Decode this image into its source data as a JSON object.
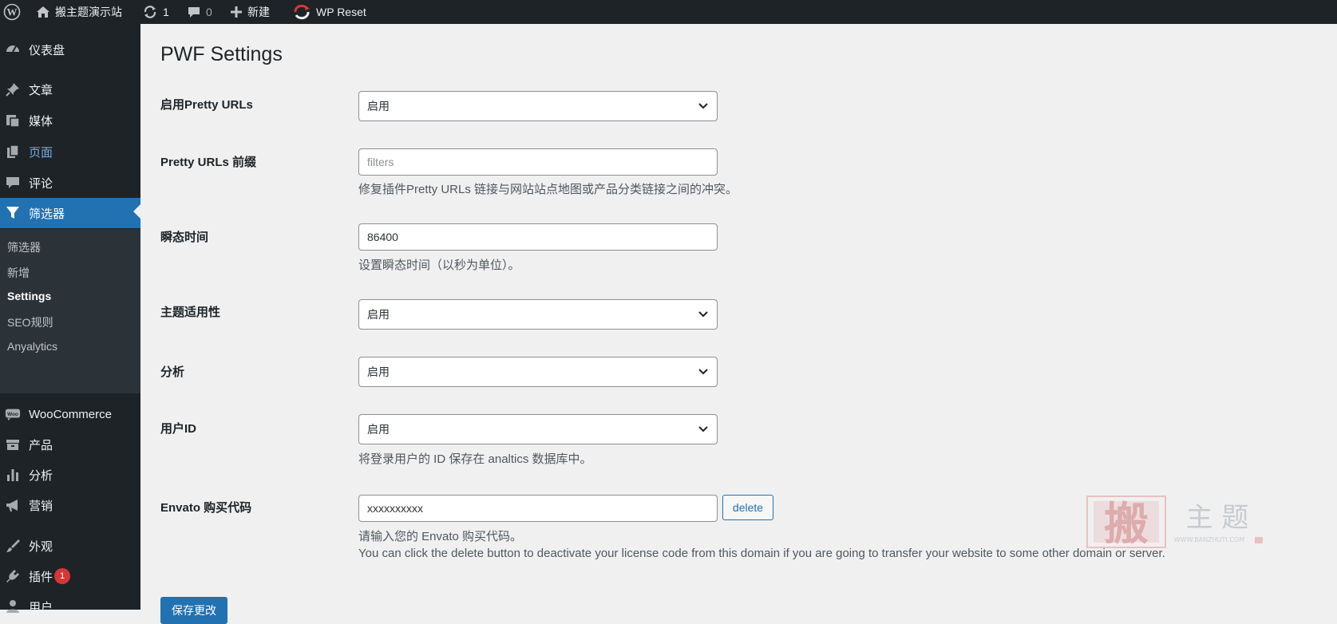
{
  "admin_bar": {
    "site_name": "搬主题演示站",
    "updates_count": "1",
    "comments_count": "0",
    "new_label": "新建",
    "wp_reset_label": "WP Reset"
  },
  "sidebar": {
    "items": [
      {
        "label": "仪表盘",
        "icon": "dashboard-icon"
      },
      {
        "label": "文章",
        "icon": "pushpin-icon"
      },
      {
        "label": "媒体",
        "icon": "media-icon"
      },
      {
        "label": "页面",
        "icon": "page-icon"
      },
      {
        "label": "评论",
        "icon": "comment-icon"
      },
      {
        "label": "筛选器",
        "icon": "filter-icon"
      },
      {
        "label": "WooCommerce",
        "icon": "woo-icon"
      },
      {
        "label": "产品",
        "icon": "archive-icon"
      },
      {
        "label": "分析",
        "icon": "chart-bar-icon"
      },
      {
        "label": "营销",
        "icon": "megaphone-icon"
      },
      {
        "label": "外观",
        "icon": "brush-icon"
      },
      {
        "label": "插件",
        "icon": "plugin-icon",
        "badge": "1"
      },
      {
        "label": "用户",
        "icon": "user-icon"
      }
    ],
    "submenu": [
      "筛选器",
      "新增",
      "Settings",
      "SEO规则",
      "Anyalytics"
    ]
  },
  "page": {
    "title": "PWF Settings",
    "pretty_urls": {
      "label": "启用Pretty URLs",
      "value": "启用"
    },
    "prefix": {
      "label": "Pretty URLs 前缀",
      "placeholder": "filters",
      "desc": "修复插件Pretty URLs 链接与网站站点地图或产品分类链接之间的冲突。"
    },
    "transient": {
      "label": "瞬态时间",
      "value": "86400",
      "desc": "设置瞬态时间（以秒为单位）。"
    },
    "theme_compat": {
      "label": "主题适用性",
      "value": "启用"
    },
    "analytics": {
      "label": "分析",
      "value": "启用"
    },
    "user_id": {
      "label": "用户ID",
      "value": "启用",
      "desc": "将登录用户的 ID 保存在 analtics 数据库中。"
    },
    "envato": {
      "label": "Envato 购买代码",
      "value": "xxxxxxxxxx",
      "delete_label": "delete",
      "desc1": "请输入您的 Envato 购买代码。",
      "desc2": "You can click the delete button to deactivate your license code from this domain if you are going to transfer your website to some other domain or server."
    },
    "save_label": "保存更改"
  },
  "watermark": {
    "glyph": "搬",
    "text": "主 题",
    "url": "WWW.BANZHUTI.COM"
  },
  "colors": {
    "accent": "#2271b1",
    "sidebar_bg": "#1d2327",
    "submenu_bg": "#2c3338",
    "badge": "#d63638"
  }
}
